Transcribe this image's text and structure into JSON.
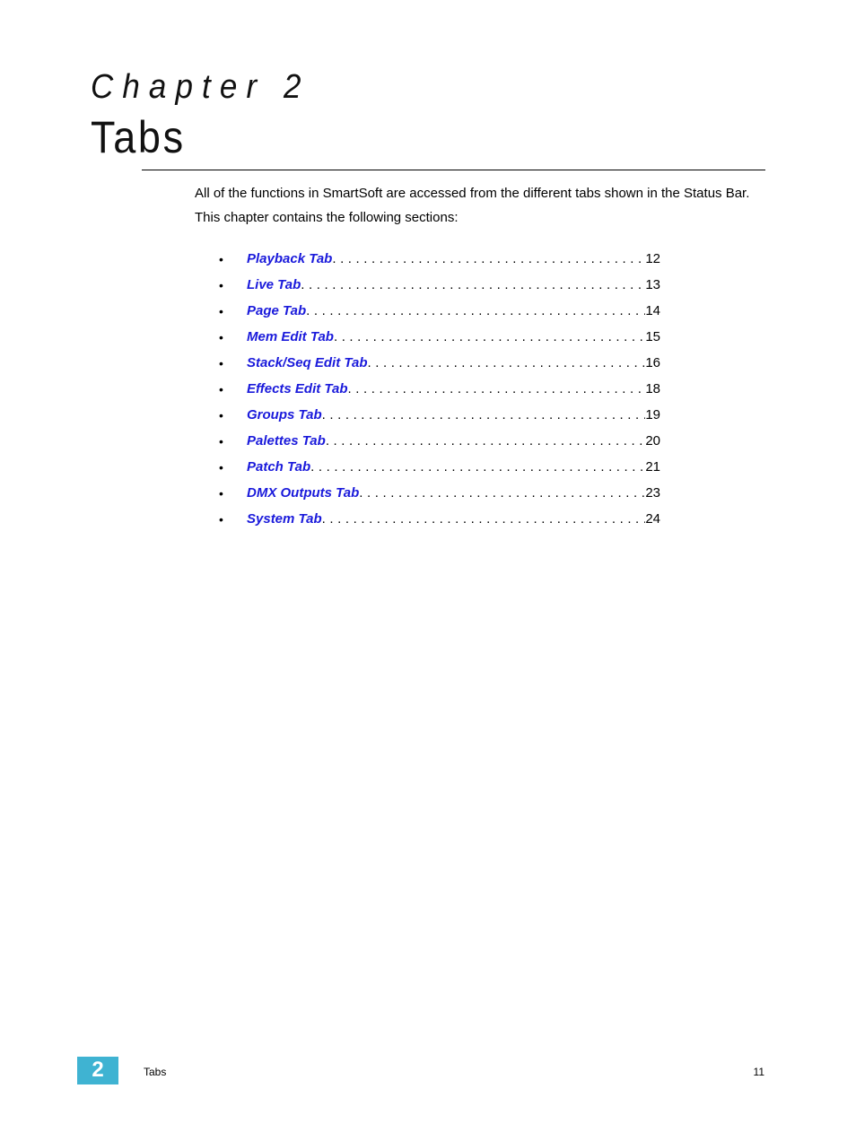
{
  "header": {
    "chapter_label": "Chapter 2",
    "chapter_title": "Tabs"
  },
  "intro": {
    "paragraph_1": "All of the functions in SmartSoft are accessed from the different tabs shown in the Status Bar.",
    "paragraph_2": "This chapter contains the following sections:"
  },
  "toc": {
    "bullet": "•",
    "items": [
      {
        "label": "Playback Tab",
        "page": "12"
      },
      {
        "label": "Live Tab",
        "page": "13"
      },
      {
        "label": "Page Tab",
        "page": "14"
      },
      {
        "label": "Mem Edit Tab",
        "page": "15"
      },
      {
        "label": "Stack/Seq Edit Tab",
        "page": "16"
      },
      {
        "label": "Effects Edit Tab",
        "page": "18"
      },
      {
        "label": "Groups Tab",
        "page": "19"
      },
      {
        "label": "Palettes Tab",
        "page": "20"
      },
      {
        "label": "Patch Tab",
        "page": "21"
      },
      {
        "label": "DMX Outputs Tab",
        "page": "23"
      },
      {
        "label": "System Tab",
        "page": "24"
      }
    ]
  },
  "footer": {
    "chapter_number": "2",
    "title": "Tabs",
    "page_number": "11"
  },
  "colors": {
    "link": "#1a1adb",
    "footer_badge": "#3fb3d2"
  }
}
